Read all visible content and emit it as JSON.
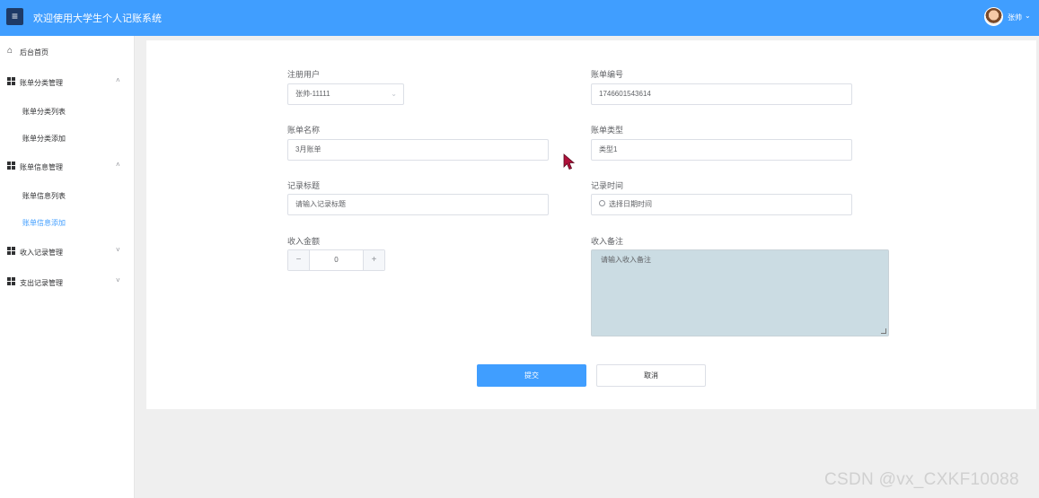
{
  "header": {
    "menu_icon": "hamburger-icon",
    "title": "欢迎使用大学生个人记账系统",
    "user": {
      "name": "张帅",
      "avatar_icon": "user-avatar",
      "caret_icon": "chevron-down-icon"
    }
  },
  "sidebar": {
    "home": {
      "label": "后台首页",
      "icon": "home-icon"
    },
    "groups": [
      {
        "label": "账单分类管理",
        "icon": "grid-icon",
        "expanded": true,
        "chevron": "˄",
        "items": [
          {
            "label": "账单分类列表"
          },
          {
            "label": "账单分类添加"
          }
        ]
      },
      {
        "label": "账单信息管理",
        "icon": "grid-icon",
        "expanded": true,
        "chevron": "˄",
        "items": [
          {
            "label": "账单信息列表"
          },
          {
            "label": "账单信息添加",
            "active": true
          }
        ]
      },
      {
        "label": "收入记录管理",
        "icon": "grid-icon",
        "expanded": false,
        "chevron": "˅",
        "items": []
      },
      {
        "label": "支出记录管理",
        "icon": "grid-icon",
        "expanded": false,
        "chevron": "˅",
        "items": []
      }
    ]
  },
  "form": {
    "user": {
      "label": "注册用户",
      "value": "张帅-11111"
    },
    "bill_no": {
      "label": "账单编号",
      "value": "1746601543614"
    },
    "bill_name": {
      "label": "账单名称",
      "value": "3月账单"
    },
    "bill_type": {
      "label": "账单类型",
      "value": "类型1"
    },
    "record_title": {
      "label": "记录标题",
      "placeholder": "请输入记录标题"
    },
    "record_time": {
      "label": "记录时间",
      "placeholder": "选择日期时间"
    },
    "amount": {
      "label": "收入金额",
      "value": "0",
      "minus": "−",
      "plus": "+"
    },
    "remark": {
      "label": "收入备注",
      "placeholder": "请输入收入备注"
    },
    "submit_label": "提交",
    "cancel_label": "取消"
  },
  "colors": {
    "primary": "#409eff",
    "header_bg": "#409eff",
    "textarea_bg": "#cbdce3",
    "cursor": "#b0103a"
  },
  "watermark": "CSDN @vx_CXKF10088"
}
